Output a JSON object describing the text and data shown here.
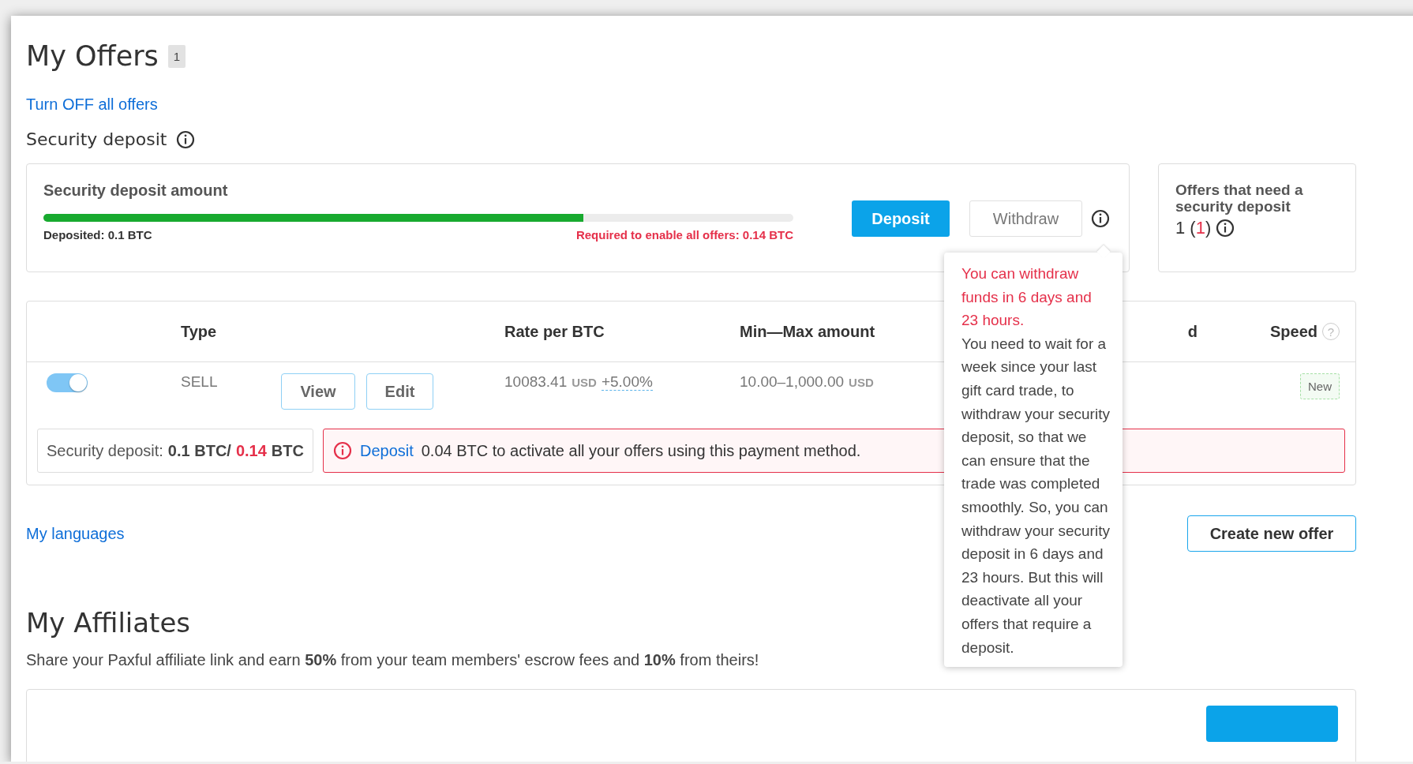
{
  "page_title": "My Offers",
  "offer_count": "1",
  "turn_off_link": "Turn OFF all offers",
  "security_deposit": {
    "heading": "Security deposit",
    "amount_label": "Security deposit amount",
    "level": 0.72,
    "deposited": "Deposited: 0.1 BTC",
    "required": "Required to enable all offers: 0.14 BTC",
    "deposit_button": "Deposit",
    "withdraw_button": "Withdraw"
  },
  "offers_needing_deposit": {
    "label": "Offers that need a security deposit",
    "count": "1",
    "open_paren": "(",
    "pending": "1",
    "close_paren": ")"
  },
  "table": {
    "columns": [
      "Type",
      "Rate per BTC",
      "Min—Max amount",
      "d",
      "Speed"
    ],
    "speed_help": "?",
    "rows": [
      {
        "active": true,
        "type": "SELL",
        "view": "View",
        "edit": "Edit",
        "rate": "10083.41",
        "rate_currency": "USD",
        "margin": "+5.00%",
        "range": "10.00–1,000.00",
        "range_currency": "USD",
        "speed": "New",
        "deposit_label": "Security deposit:",
        "deposit_have": "0.1 BTC/",
        "deposit_need": "0.14",
        "deposit_unit": "BTC",
        "alert_link": "Deposit",
        "alert_text": "0.04 BTC to activate all your offers using this payment method."
      }
    ]
  },
  "tooltip": {
    "title": "You can withdraw funds in 6 days and 23 hours.",
    "body": "You need to wait for a week since your last gift card trade, to withdraw your security deposit, so that we can ensure that the trade was completed smoothly. So, you can withdraw your security deposit in 6 days and 23 hours. But this will deactivate all your offers that require a deposit."
  },
  "languages_link": "My languages",
  "create_button": "Create new offer",
  "affiliates": {
    "title": "My Affiliates",
    "text": "Share your Paxful affiliate link and earn **50%** from your team members' escrow fees and **10%** from theirs!"
  }
}
